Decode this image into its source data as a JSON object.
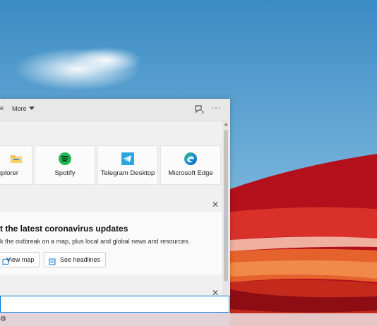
{
  "titlebar": {
    "more_label": "More"
  },
  "tiles": [
    {
      "label": "xplorer",
      "icon": "file-explorer-icon"
    },
    {
      "label": "Spotify",
      "icon": "spotify-icon"
    },
    {
      "label": "Telegram Desktop",
      "icon": "telegram-icon"
    },
    {
      "label": "Microsoft Edge",
      "icon": "edge-icon"
    }
  ],
  "news": {
    "title": "t the latest coronavirus updates",
    "description": "k the outbreak on a map, plus local and global news and resources.",
    "buttons": {
      "view_map": "View map",
      "see_headlines": "See headlines"
    }
  },
  "search": {
    "value": ""
  },
  "colors": {
    "accent": "#0078d7",
    "spotify": "#1db954",
    "telegram": "#2ca5e0"
  }
}
